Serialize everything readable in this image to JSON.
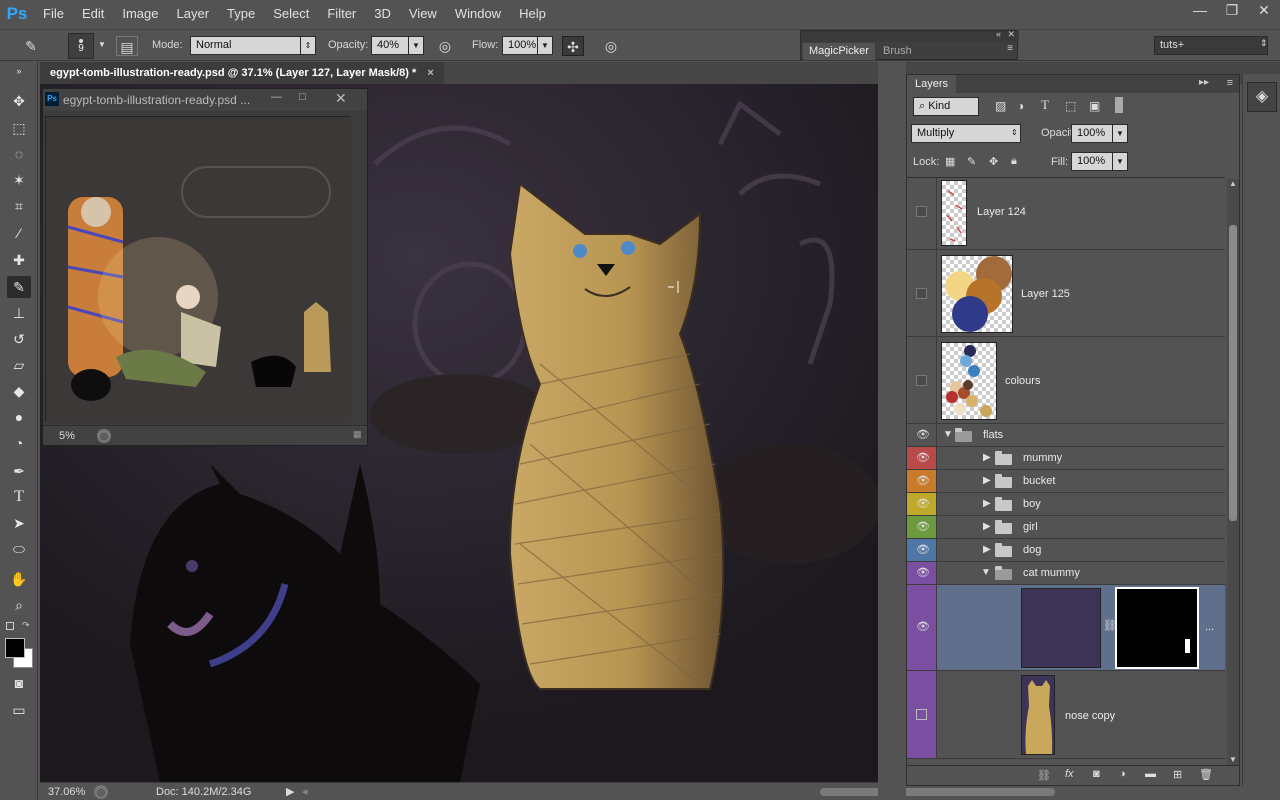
{
  "app": {
    "logo": "Ps",
    "menu": [
      "File",
      "Edit",
      "Image",
      "Layer",
      "Type",
      "Select",
      "Filter",
      "3D",
      "View",
      "Window",
      "Help"
    ],
    "win_buttons": [
      "—",
      "❐",
      "✕"
    ]
  },
  "options": {
    "brush_size": "9",
    "mode_label": "Mode:",
    "mode_value": "Normal",
    "opacity_label": "Opacity:",
    "opacity_value": "40%",
    "flow_label": "Flow:",
    "flow_value": "100%",
    "panel_tabs": [
      "MagicPicker",
      "Brush"
    ],
    "workspace": "tuts+"
  },
  "document": {
    "tab_title": "egypt-tomb-illustration-ready.psd @ 37.1% (Layer 127, Layer Mask/8) *",
    "tab_close": "×"
  },
  "navigator": {
    "title": "egypt-tomb-illustration-ready.psd ...",
    "zoom": "5%"
  },
  "status": {
    "zoom": "37.06%",
    "doc": "Doc: 140.2M/2.34G"
  },
  "layers": {
    "panel_title": "Layers",
    "filter_kind": "Kind",
    "blend_mode": "Multiply",
    "opacity_label": "Opacity:",
    "opacity_value": "100%",
    "lock_label": "Lock:",
    "fill_label": "Fill:",
    "fill_value": "100%",
    "items": [
      {
        "name": "Layer 124"
      },
      {
        "name": "Layer 125"
      },
      {
        "name": "colours"
      },
      {
        "name": "flats"
      },
      {
        "name": "mummy"
      },
      {
        "name": "bucket"
      },
      {
        "name": "boy"
      },
      {
        "name": "girl"
      },
      {
        "name": "dog"
      },
      {
        "name": "cat mummy"
      },
      {
        "name": ""
      },
      {
        "name": "nose copy"
      }
    ],
    "group_colors": {
      "flats": "#535353",
      "mummy": "#b94a4a",
      "bucket": "#c77b2b",
      "boy": "#bfa92a",
      "girl": "#6e9a3f",
      "dog": "#4f77a6",
      "cat_mummy": "#7a4fa1"
    },
    "more": "..."
  }
}
